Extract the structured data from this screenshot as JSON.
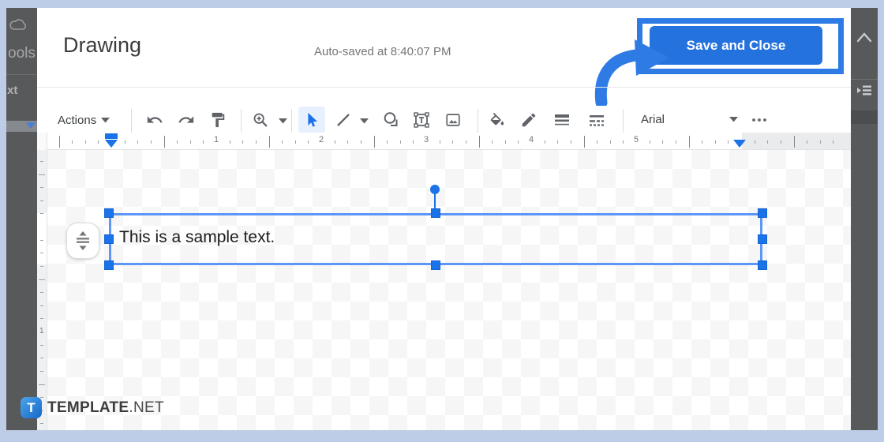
{
  "window": {
    "title": "Drawing",
    "autosave_text": "Auto-saved at 8:40:07 PM",
    "save_button_label": "Save and Close"
  },
  "toolbar": {
    "actions_label": "Actions",
    "font_name": "Arial",
    "tools": [
      "undo",
      "redo",
      "paint-format",
      "zoom",
      "select",
      "line",
      "shape",
      "text-box",
      "image",
      "fill-color",
      "line-color",
      "line-weight",
      "line-dash",
      "more-options"
    ],
    "active_tool": "select"
  },
  "ruler": {
    "horizontal_numbers": [
      1,
      2,
      3,
      4,
      5
    ],
    "vertical_numbers": [
      1
    ],
    "left_margin_marker_inch": 0,
    "right_margin_marker_inch": 6
  },
  "canvas": {
    "textbox_text": "This is a sample text."
  },
  "background": {
    "fragments": [
      "ools",
      "xt"
    ]
  },
  "watermark": {
    "logo_letter": "T",
    "brand_bold": "TEMPLATE",
    "brand_suffix": ".NET"
  },
  "colors": {
    "accent_blue": "#1a73e8",
    "save_button_blue": "#2472dd",
    "annotation_blue": "#2e7be5",
    "selection_blue": "#4285f4",
    "page_border_blue": "#bdcde7",
    "dimmed_overlay": "#58595b"
  }
}
